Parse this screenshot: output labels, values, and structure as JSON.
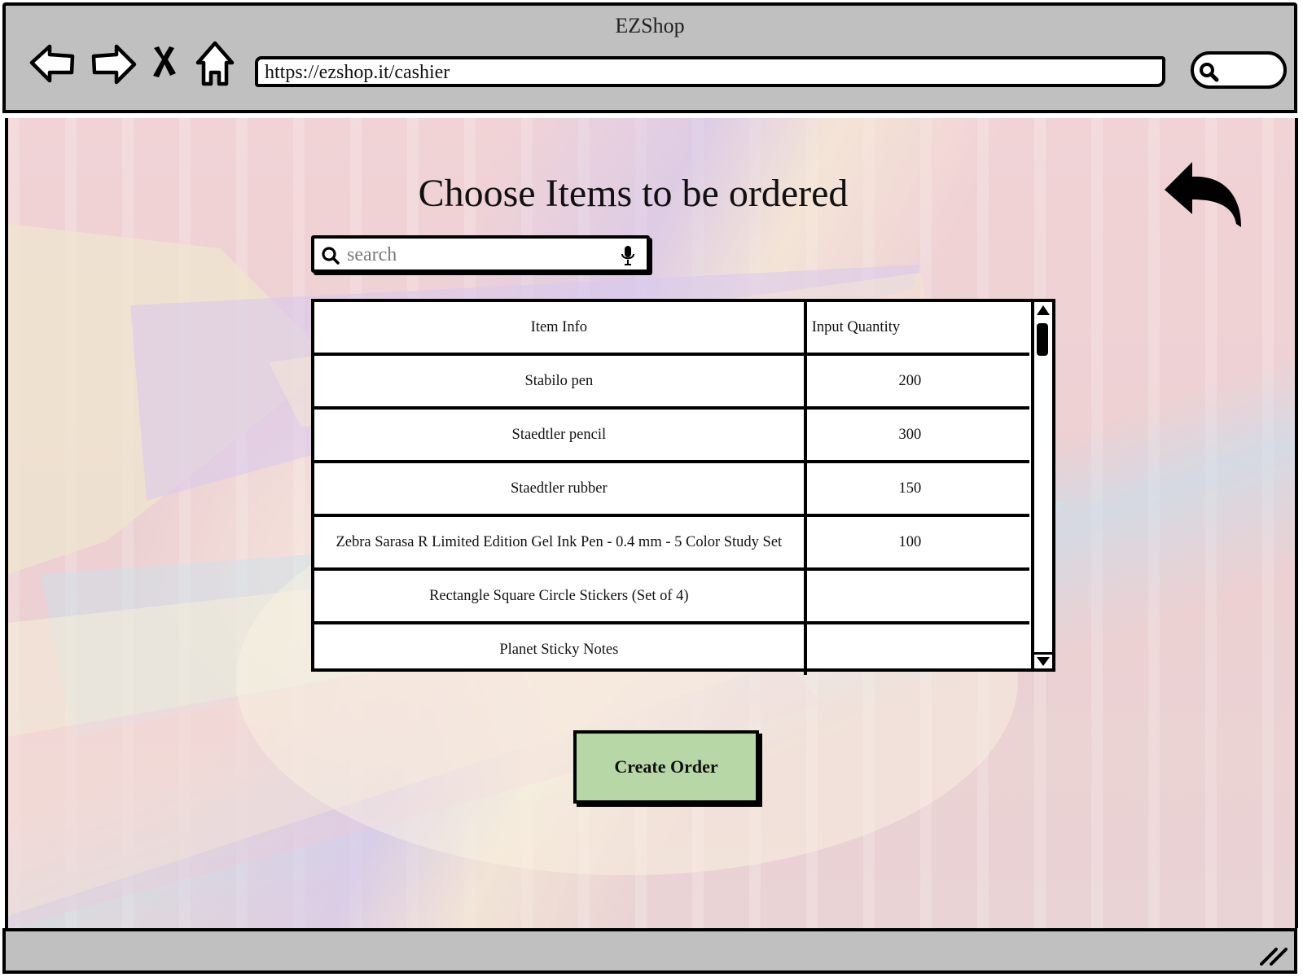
{
  "browser": {
    "window_title": "EZShop",
    "url": "https://ezshop.it/cashier",
    "icons": [
      "back-icon",
      "forward-icon",
      "close-icon",
      "home-icon",
      "search-icon"
    ]
  },
  "page": {
    "title": "Choose Items to be ordered",
    "back_icon": "undo-arrow-icon"
  },
  "search": {
    "placeholder": "search",
    "value": ""
  },
  "table": {
    "headers": [
      "Item Info",
      "Input Quantity"
    ],
    "rows": [
      {
        "item": "Stabilo pen",
        "quantity": "200"
      },
      {
        "item": "Staedtler pencil",
        "quantity": "300"
      },
      {
        "item": "Staedtler rubber",
        "quantity": "150"
      },
      {
        "item": "Zebra Sarasa R Limited Edition Gel Ink Pen - 0.4 mm - 5 Color Study Set",
        "quantity": "100"
      },
      {
        "item": "Rectangle Square Circle Stickers (Set of 4)",
        "quantity": ""
      },
      {
        "item": "Planet Sticky Notes",
        "quantity": ""
      }
    ]
  },
  "actions": {
    "create_order_label": "Create Order"
  },
  "colors": {
    "chrome": "#c0c0c0",
    "button_green": "#b7d8a6",
    "background_pink": "#ecd0d2"
  }
}
